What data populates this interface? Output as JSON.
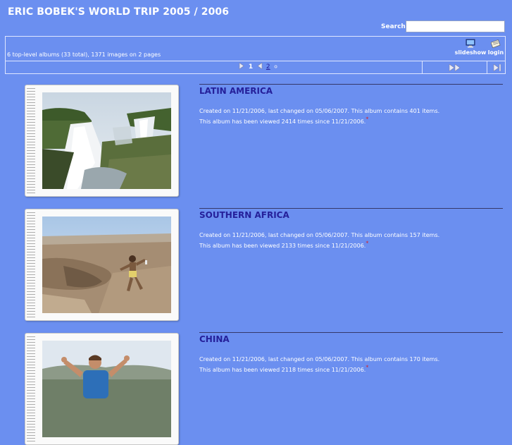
{
  "header": {
    "title": "ERIC BOBEK'S WORLD TRIP 2005 / 2006",
    "search_label": "Search:",
    "search_value": ""
  },
  "toolbar": {
    "summary": "6 top-level albums (33 total), 1371 images on 2 pages",
    "slideshow_label": "slideshow",
    "login_label": "login"
  },
  "pager": {
    "current_page": "1",
    "other_page": "2"
  },
  "albums": [
    {
      "title": "LATIN AMERICA",
      "created": "Created on 11/21/2006, last changed on 05/06/2007. This album contains 401 items.",
      "views": "This album has been viewed 2414 times since 11/21/2006."
    },
    {
      "title": "SOUTHERN AFRICA",
      "created": "Created on 11/21/2006, last changed on 05/06/2007. This album contains 157 items.",
      "views": "This album has been viewed 2133 times since 11/21/2006."
    },
    {
      "title": "CHINA",
      "created": "Created on 11/21/2006, last changed on 05/06/2007. This album contains 170 items.",
      "views": "This album has been viewed 2118 times since 11/21/2006."
    }
  ],
  "colors": {
    "page_background": "#6b8ff0",
    "title_link": "#25209a",
    "new_star": "#d4242a"
  },
  "icons": [
    "monitor-icon",
    "login-icon",
    "next-page-icon",
    "prev-page-icon",
    "fast-forward-icon",
    "last-page-icon",
    "new-star-icon"
  ]
}
